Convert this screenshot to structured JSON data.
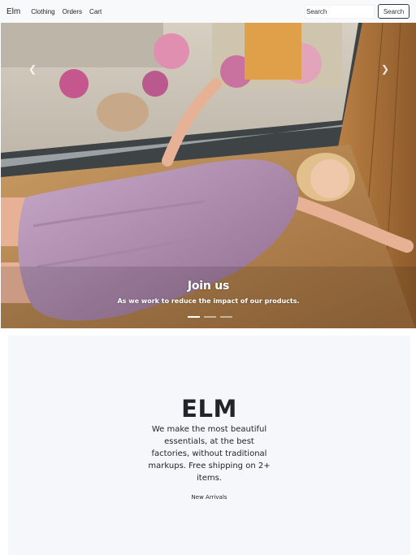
{
  "navbar": {
    "brand": "Elm",
    "links": [
      {
        "label": "Clothing"
      },
      {
        "label": "Orders"
      },
      {
        "label": "Cart"
      }
    ],
    "search": {
      "placeholder": "Search",
      "button_label": "Search"
    }
  },
  "carousel": {
    "prev_icon": "chevron-left-icon",
    "next_icon": "chevron-right-icon",
    "caption_title": "Join us",
    "caption_text": "As we work to reduce the impact of our products.",
    "indicator_count": 3,
    "active_index": 0
  },
  "hero": {
    "title": "ELM",
    "lead": "We make the most beautiful essentials, at the best factories, without traditional markups. Free shipping on 2+ items.",
    "link_label": "New Arrivals"
  }
}
